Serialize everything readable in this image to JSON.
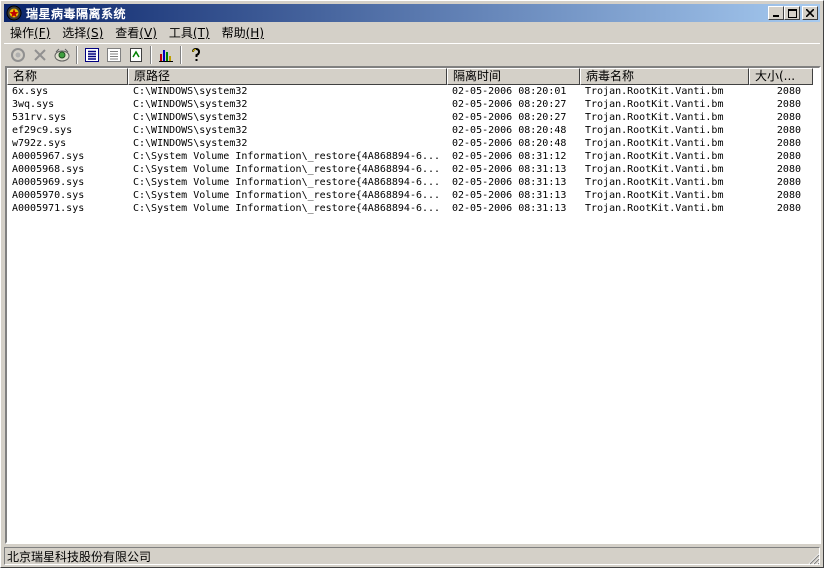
{
  "window": {
    "title": "瑞星病毒隔离系统",
    "icon": "rising-app-icon"
  },
  "menu": [
    {
      "label": "操作",
      "key": "(F)"
    },
    {
      "label": "选择",
      "key": "(S)"
    },
    {
      "label": "查看",
      "key": "(V)"
    },
    {
      "label": "工具",
      "key": "(T)"
    },
    {
      "label": "帮助",
      "key": "(H)"
    }
  ],
  "toolbar": {
    "icons": [
      "restore-icon",
      "delete-icon",
      "scan-icon",
      "details-view-icon",
      "list-view-icon",
      "refresh-icon",
      "statistics-icon",
      "help-icon"
    ]
  },
  "table": {
    "columns": [
      "名称",
      "原路径",
      "隔离时间",
      "病毒名称",
      "大小(..."
    ],
    "rows": [
      [
        "6x.sys",
        "C:\\WINDOWS\\system32",
        "02-05-2006 08:20:01",
        "Trojan.RootKit.Vanti.bm",
        "2080"
      ],
      [
        "3wq.sys",
        "C:\\WINDOWS\\system32",
        "02-05-2006 08:20:27",
        "Trojan.RootKit.Vanti.bm",
        "2080"
      ],
      [
        "531rv.sys",
        "C:\\WINDOWS\\system32",
        "02-05-2006 08:20:27",
        "Trojan.RootKit.Vanti.bm",
        "2080"
      ],
      [
        "ef29c9.sys",
        "C:\\WINDOWS\\system32",
        "02-05-2006 08:20:48",
        "Trojan.RootKit.Vanti.bm",
        "2080"
      ],
      [
        "w792z.sys",
        "C:\\WINDOWS\\system32",
        "02-05-2006 08:20:48",
        "Trojan.RootKit.Vanti.bm",
        "2080"
      ],
      [
        "A0005967.sys",
        "C:\\System Volume Information\\_restore{4A868894-6...",
        "02-05-2006 08:31:12",
        "Trojan.RootKit.Vanti.bm",
        "2080"
      ],
      [
        "A0005968.sys",
        "C:\\System Volume Information\\_restore{4A868894-6...",
        "02-05-2006 08:31:13",
        "Trojan.RootKit.Vanti.bm",
        "2080"
      ],
      [
        "A0005969.sys",
        "C:\\System Volume Information\\_restore{4A868894-6...",
        "02-05-2006 08:31:13",
        "Trojan.RootKit.Vanti.bm",
        "2080"
      ],
      [
        "A0005970.sys",
        "C:\\System Volume Information\\_restore{4A868894-6...",
        "02-05-2006 08:31:13",
        "Trojan.RootKit.Vanti.bm",
        "2080"
      ],
      [
        "A0005971.sys",
        "C:\\System Volume Information\\_restore{4A868894-6...",
        "02-05-2006 08:31:13",
        "Trojan.RootKit.Vanti.bm",
        "2080"
      ]
    ]
  },
  "status": {
    "text": "北京瑞星科技股份有限公司"
  },
  "colors": {
    "title_start": "#0a246a",
    "title_end": "#a6caf0",
    "face": "#d4d0c8"
  }
}
